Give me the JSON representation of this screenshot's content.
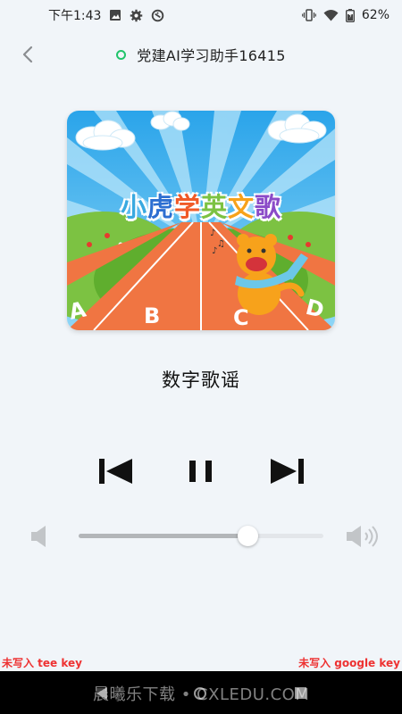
{
  "status_bar": {
    "time": "下午1:43",
    "battery": "62%",
    "icons": [
      "image-icon",
      "gear-icon",
      "sync-icon",
      "vibrate-icon",
      "wifi-icon",
      "battery-icon"
    ]
  },
  "header": {
    "title": "党建AI学习助手16415",
    "status_color": "#21c46b"
  },
  "cover": {
    "title_chars": [
      "小",
      "虎",
      "学",
      "英",
      "文",
      "歌"
    ],
    "letters": [
      "A",
      "B",
      "C",
      "D"
    ]
  },
  "player": {
    "song_title": "数字歌谣",
    "volume_level": 0.69
  },
  "footer": {
    "warning_left": "未写入 tee key",
    "warning_right": "未写入 google key",
    "watermark": "晨曦乐下载 • CXLEDU.COM",
    "warning_color": "#ee3131"
  }
}
